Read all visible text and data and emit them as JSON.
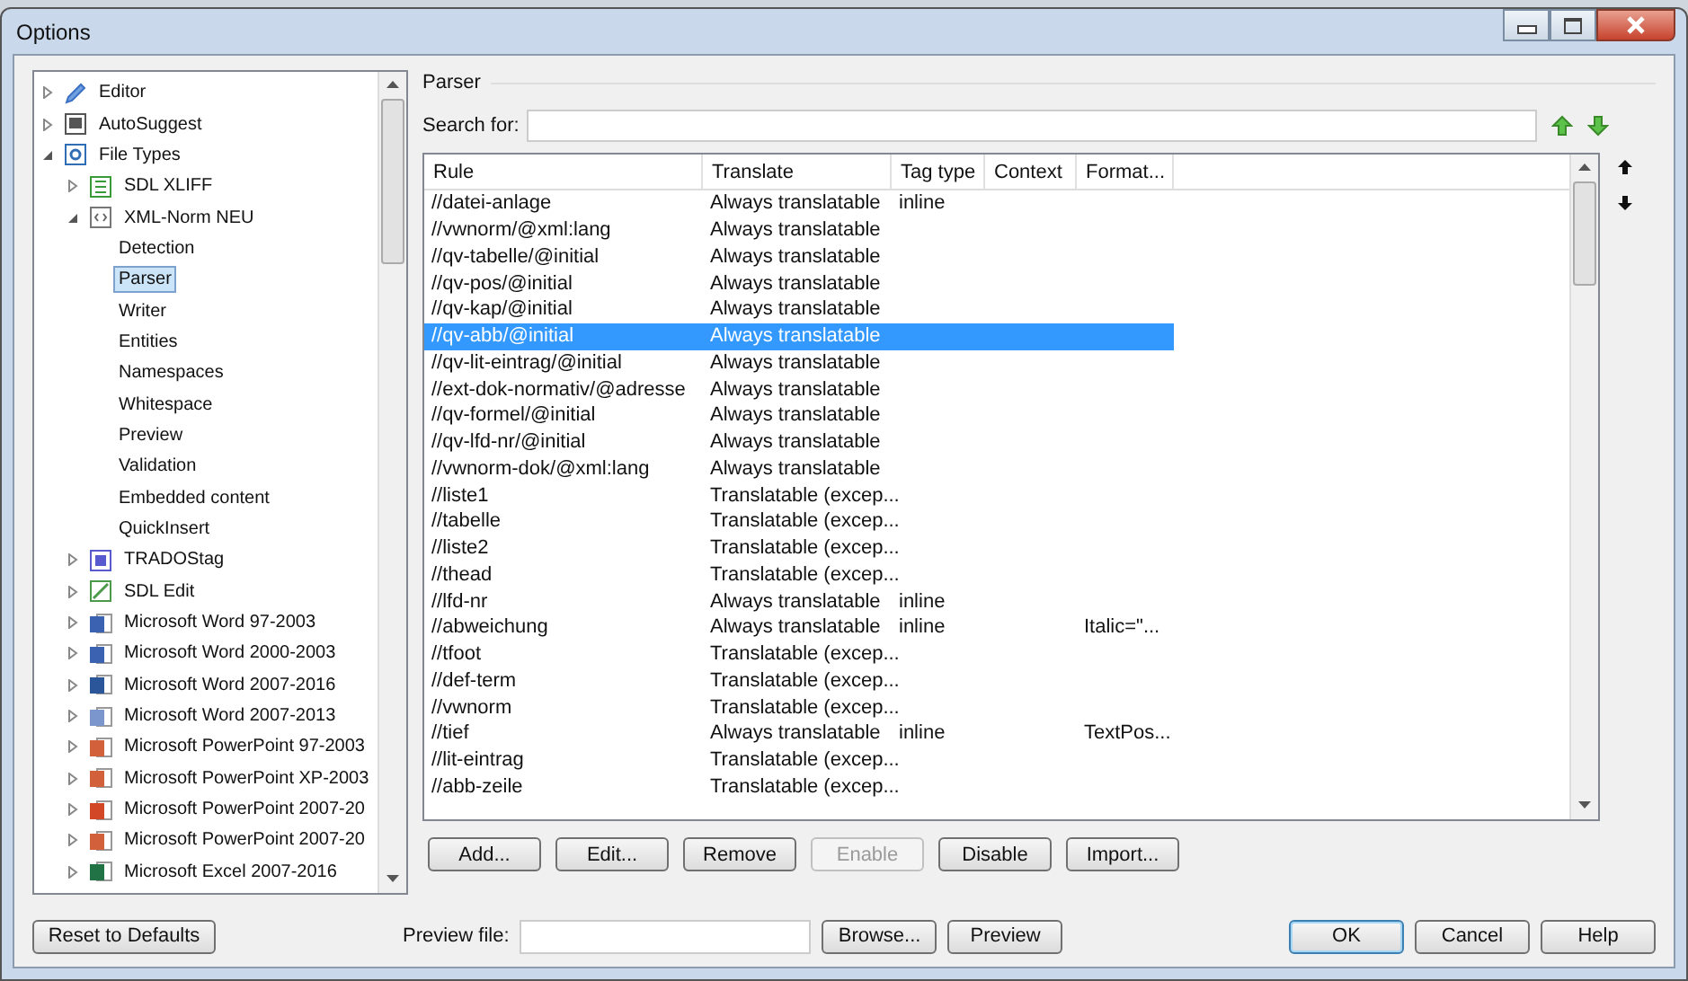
{
  "window": {
    "title": "Options"
  },
  "tree": {
    "items": [
      {
        "label": "Editor",
        "kind": "pencil",
        "expanded": false,
        "selected": false
      },
      {
        "label": "AutoSuggest",
        "kind": "monitor",
        "expanded": false,
        "selected": false
      },
      {
        "label": "File Types",
        "kind": "gear",
        "expanded": true,
        "selected": false,
        "children": [
          {
            "label": "SDL XLIFF",
            "kind": "sheet",
            "expanded": false,
            "selected": false
          },
          {
            "label": "XML-Norm NEU",
            "kind": "xml",
            "expanded": true,
            "selected": false,
            "children": [
              {
                "label": "Detection",
                "kind": "leaf",
                "selected": false
              },
              {
                "label": "Parser",
                "kind": "leaf",
                "selected": true
              },
              {
                "label": "Writer",
                "kind": "leaf",
                "selected": false
              },
              {
                "label": "Entities",
                "kind": "leaf",
                "selected": false
              },
              {
                "label": "Namespaces",
                "kind": "leaf",
                "selected": false
              },
              {
                "label": "Whitespace",
                "kind": "leaf",
                "selected": false
              },
              {
                "label": "Preview",
                "kind": "leaf",
                "selected": false
              },
              {
                "label": "Validation",
                "kind": "leaf",
                "selected": false
              },
              {
                "label": "Embedded content",
                "kind": "leaf",
                "selected": false
              },
              {
                "label": "QuickInsert",
                "kind": "leaf",
                "selected": false
              }
            ]
          },
          {
            "label": "TRADOStag",
            "kind": "tag",
            "expanded": false,
            "selected": false
          },
          {
            "label": "SDL Edit",
            "kind": "pencil-box",
            "expanded": false,
            "selected": false
          },
          {
            "label": "Microsoft Word 97-2003",
            "kind": "word-old",
            "expanded": false,
            "selected": false
          },
          {
            "label": "Microsoft Word 2000-2003",
            "kind": "word-old",
            "expanded": false,
            "selected": false
          },
          {
            "label": "Microsoft Word 2007-2016",
            "kind": "word",
            "expanded": false,
            "selected": false
          },
          {
            "label": "Microsoft Word 2007-2013",
            "kind": "word-light",
            "expanded": false,
            "selected": false
          },
          {
            "label": "Microsoft PowerPoint 97-2003",
            "kind": "ppt-old",
            "expanded": false,
            "selected": false
          },
          {
            "label": "Microsoft PowerPoint XP-2003",
            "kind": "ppt-old",
            "expanded": false,
            "selected": false
          },
          {
            "label": "Microsoft PowerPoint 2007-20",
            "kind": "ppt",
            "expanded": false,
            "selected": false
          },
          {
            "label": "Microsoft PowerPoint 2007-20",
            "kind": "ppt-old",
            "expanded": false,
            "selected": false
          },
          {
            "label": "Microsoft Excel 2007-2016",
            "kind": "excel",
            "expanded": false,
            "selected": false
          }
        ]
      }
    ]
  },
  "panel": {
    "title": "Parser",
    "search_label": "Search for:"
  },
  "table": {
    "columns": [
      "Rule",
      "Translate",
      "Tag type",
      "Context",
      "Format..."
    ],
    "rows": [
      {
        "rule": "//datei-anlage",
        "translate": "Always translatable",
        "tag_type": "inline",
        "selected": false
      },
      {
        "rule": "//vwnorm/@xml:lang",
        "translate": "Always translatable",
        "selected": false
      },
      {
        "rule": "//qv-tabelle/@initial",
        "translate": "Always translatable",
        "selected": false
      },
      {
        "rule": "//qv-pos/@initial",
        "translate": "Always translatable",
        "selected": false
      },
      {
        "rule": "//qv-kap/@initial",
        "translate": "Always translatable",
        "selected": false
      },
      {
        "rule": "//qv-abb/@initial",
        "translate": "Always translatable",
        "selected": true
      },
      {
        "rule": "//qv-lit-eintrag/@initial",
        "translate": "Always translatable",
        "selected": false
      },
      {
        "rule": "//ext-dok-normativ/@adresse",
        "translate": "Always translatable",
        "selected": false
      },
      {
        "rule": "//qv-formel/@initial",
        "translate": "Always translatable",
        "selected": false
      },
      {
        "rule": "//qv-lfd-nr/@initial",
        "translate": "Always translatable",
        "selected": false
      },
      {
        "rule": "//vwnorm-dok/@xml:lang",
        "translate": "Always translatable",
        "selected": false
      },
      {
        "rule": "//liste1",
        "translate": "Translatable (excep...",
        "selected": false
      },
      {
        "rule": "//tabelle",
        "translate": "Translatable (excep...",
        "selected": false
      },
      {
        "rule": "//liste2",
        "translate": "Translatable (excep...",
        "selected": false
      },
      {
        "rule": "//thead",
        "translate": "Translatable (excep...",
        "selected": false
      },
      {
        "rule": "//lfd-nr",
        "translate": "Always translatable",
        "tag_type": "inline",
        "selected": false
      },
      {
        "rule": "//abweichung",
        "translate": "Always translatable",
        "tag_type": "inline",
        "format": "Italic=\"...",
        "selected": false
      },
      {
        "rule": "//tfoot",
        "translate": "Translatable (excep...",
        "selected": false
      },
      {
        "rule": "//def-term",
        "translate": "Translatable (excep...",
        "selected": false
      },
      {
        "rule": "//vwnorm",
        "translate": "Translatable (excep...",
        "selected": false
      },
      {
        "rule": "//tief",
        "translate": "Always translatable",
        "tag_type": "inline",
        "format": "TextPos...",
        "selected": false
      },
      {
        "rule": "//lit-eintrag",
        "translate": "Translatable (excep...",
        "selected": false
      },
      {
        "rule": "//abb-zeile",
        "translate": "Translatable (excep...",
        "selected": false
      }
    ]
  },
  "actions": [
    {
      "label": "Add...",
      "disabled": false
    },
    {
      "label": "Edit...",
      "disabled": false
    },
    {
      "label": "Remove",
      "disabled": false
    },
    {
      "label": "Enable",
      "disabled": true
    },
    {
      "label": "Disable",
      "disabled": false
    },
    {
      "label": "Import...",
      "disabled": false
    }
  ],
  "footer": {
    "reset": "Reset to Defaults",
    "preview_label": "Preview file:",
    "browse": "Browse...",
    "preview": "Preview",
    "buttons": [
      "OK",
      "Cancel",
      "Help"
    ]
  }
}
